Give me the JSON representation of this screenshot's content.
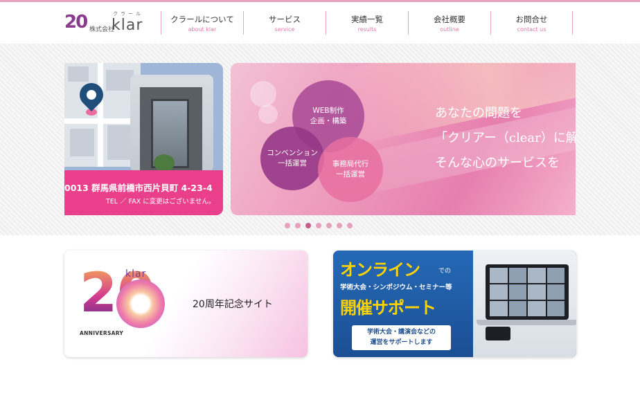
{
  "brand": {
    "anniversary_number": "20",
    "kana": "クラール",
    "corp": "株式会社",
    "name": "klar"
  },
  "nav": [
    {
      "label": "クラールについて",
      "sub": "about klar"
    },
    {
      "label": "サービス",
      "sub": "service"
    },
    {
      "label": "実績一覧",
      "sub": "results"
    },
    {
      "label": "会社概要",
      "sub": "outline"
    },
    {
      "label": "お問合せ",
      "sub": "contact us"
    }
  ],
  "slider": {
    "left_slide": {
      "address": "0013 群馬県前橋市西片貝町 4-23-4",
      "note": "TEL ／ FAX に変更はございません。"
    },
    "main_slide": {
      "circles": [
        {
          "line1": "WEB制作",
          "line2": "企画・構築"
        },
        {
          "line1": "コンベンション",
          "line2": "一括運営"
        },
        {
          "line1": "事務局代行",
          "line2": "一括運営"
        }
      ],
      "tagline": [
        "あなたの問題を",
        "「クリアー（clear）に解",
        "そんな心のサービスを"
      ]
    },
    "dots_count": 7,
    "active_dot": 2
  },
  "banners": {
    "anniversary": {
      "number": "20",
      "logo": "klar",
      "anniversary_label": "ANNIVERSARY",
      "title": "20周年記念サイト"
    },
    "online": {
      "headline": "オンライン",
      "suffix": "での",
      "subline": "学術大会・シンポジウム・セミナー等",
      "headline2": "開催サポート",
      "box_line1": "学術大会・講演会などの",
      "box_line2": "運営をサポートします"
    }
  },
  "colors": {
    "accent_pink": "#e07aa1",
    "divider": "#e8a6bf",
    "slide_pink": "#ea3f8a",
    "banner_blue": "#1f5fa8",
    "banner_yellow": "#ffd400"
  }
}
